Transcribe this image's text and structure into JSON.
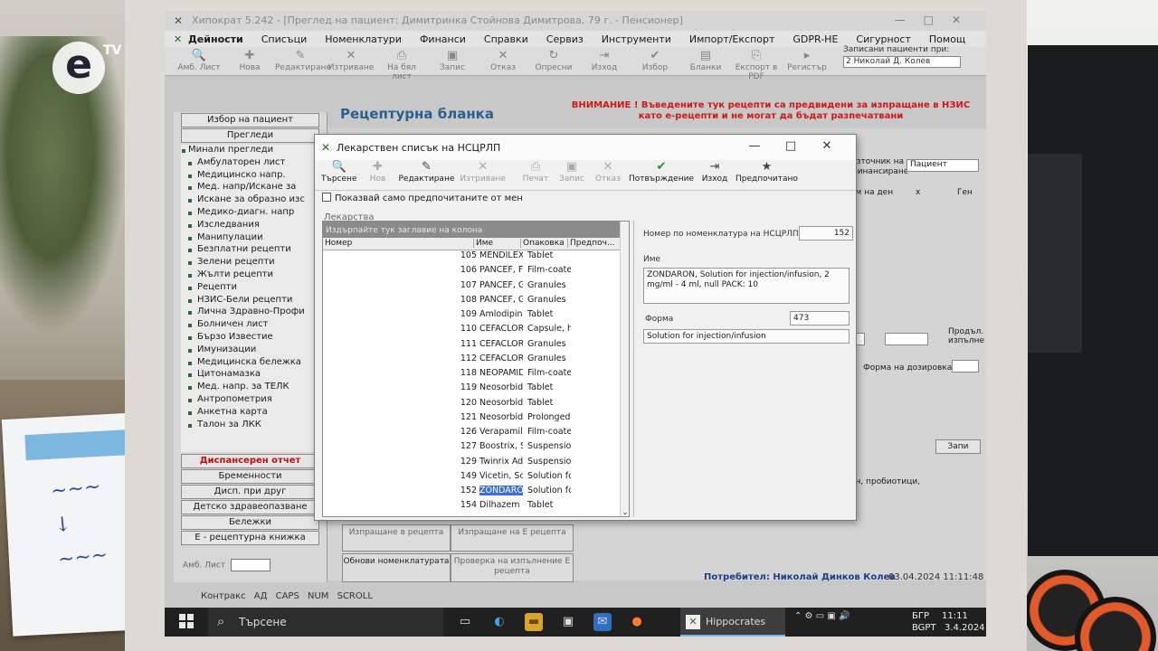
{
  "app": {
    "title": "Хипократ 5.242 - [Преглед на пациент: Димитринка Стойнова Димитрова, 79 г. - Пенсионер]",
    "window_controls": [
      "—",
      "□",
      "✕"
    ]
  },
  "menu": [
    "Дейности",
    "Списъци",
    "Номенклатури",
    "Финанси",
    "Справки",
    "Сервиз",
    "Инструменти",
    "Импорт/Експорт",
    "GDPR-НЕ",
    "Сигурност",
    "Помощ"
  ],
  "menu_right": {
    "label": "Записани пациенти при:",
    "value": "2 Николай Д. Колев"
  },
  "toolbar": [
    "Амб. Лист",
    "Нова",
    "Редактиране",
    "Изтриване",
    "На бял лист",
    "Запис",
    "Отказ",
    "Опресни",
    "Изход",
    "Избор",
    "Бланки",
    "Експорт в PDF",
    "Регистър"
  ],
  "left_panel": {
    "patient_button": "Избор на пациент",
    "reviews_button": "Прегледи",
    "tree": [
      "Минали прегледи",
      "Амбулаторен лист",
      "Медицинско напр.",
      "Мед. напр/Искане за",
      "Искане за образно изс",
      "Медико-диагн. напр",
      "Изследвания",
      "Манипулации",
      "Безплатни рецепти",
      "Зелени рецепти",
      "Жълти рецепти",
      "Рецепти",
      "НЗИС-Бели рецепти",
      "Лична Здравно-Профи",
      "Болничен лист",
      "Бързо Известие",
      "Имунизации",
      "Медицинска бележка",
      "Цитонамазка",
      "Мед. напр. за ТЕЛК",
      "Антропометрия",
      "Анкетна карта",
      "Талон за ЛКК"
    ],
    "buttons": [
      "Диспансерен отчет",
      "Бременности",
      "Дисп. при друг",
      "Детско здравеопазване",
      "Бележки",
      "Е - рецептурна книжка"
    ],
    "amb_list_label": "Амб. Лист"
  },
  "main": {
    "title": "Рецептурна бланка",
    "warning": "ВНИМАНИЕ ! Въведените тук рецепти са предвидени за изпращане в НЗИС като е-рецепти и не могат да бъдат разпечатвани",
    "source_label": "Източник на финансиране",
    "source_value": "Пациент",
    "per_day_label": "ем на ден",
    "times_label": "x",
    "gen_label": "Ген",
    "duration_label": "Продъл. изпълне",
    "dose_form_label": "Форма на дозировка",
    "save_label": "Запи",
    "probiotics_text": "ен, пробиотици,",
    "bottom_buttons": [
      "Изпращане в рецепта",
      "Изпращане на Е рецепта",
      "Обнови номенклатурата",
      "Проверка на изпълнение Е рецепта"
    ],
    "status_user": "Потребител: Николай Динков Колев",
    "status_datetime": "03.04.2024 11:11:48",
    "statusbar": "Контракс АД  CAPS  NUM  SCROLL"
  },
  "dialog": {
    "title": "Лекарствен списък на НСЦРЛП",
    "toolbar": [
      "Търсене",
      "Нов",
      "Редактиране",
      "Изтриване",
      "Печат",
      "Запис",
      "Отказ",
      "Потвърждение",
      "Изход",
      "Предпочитано"
    ],
    "checkbox_label": "Показвай само предпочитаните от мен",
    "group_label": "Лекарства",
    "group_hint": "Издърпайте тук заглавие на колона",
    "columns": [
      "Номер",
      "Име",
      "Опаковка",
      "Предпоч..."
    ],
    "rows": [
      {
        "no": "105",
        "name": "MENDILEX",
        "form": "Tablet"
      },
      {
        "no": "106",
        "name": "PANCEF, Fi",
        "form": "Film-coated"
      },
      {
        "no": "107",
        "name": "PANCEF, G",
        "form": "Granules"
      },
      {
        "no": "108",
        "name": "PANCEF, G",
        "form": "Granules"
      },
      {
        "no": "109",
        "name": "Amlodipin A",
        "form": "Tablet"
      },
      {
        "no": "110",
        "name": "CEFACLOR",
        "form": "Capsule, ha"
      },
      {
        "no": "111",
        "name": "CEFACLOR",
        "form": "Granules"
      },
      {
        "no": "112",
        "name": "CEFACLOR",
        "form": "Granules"
      },
      {
        "no": "118",
        "name": "NEOPAMID",
        "form": "Film-coated"
      },
      {
        "no": "119",
        "name": "Neosorbid,",
        "form": "Tablet"
      },
      {
        "no": "120",
        "name": "Neosorbid,",
        "form": "Tablet"
      },
      {
        "no": "121",
        "name": "Neosorbid, I",
        "form": "Prolonged-r"
      },
      {
        "no": "126",
        "name": "Verapamil S",
        "form": "Film-coated"
      },
      {
        "no": "127",
        "name": "Boostrix, Su",
        "form": "Suspension"
      },
      {
        "no": "129",
        "name": "Twinrix Adu",
        "form": "Suspension"
      },
      {
        "no": "149",
        "name": "Vicetin, Sol",
        "form": "Solution for"
      },
      {
        "no": "152",
        "name": "ZONDARO",
        "form": "Solution for",
        "selected": true
      },
      {
        "no": "154",
        "name": "Dilhazem Sc",
        "form": "Tablet"
      }
    ],
    "detail": {
      "nomenclature_label": "Номер по номенклатура на НСЦРЛП",
      "nomenclature_value": "152",
      "name_label": "Име",
      "name_value": "ZONDARON, Solution for injection/infusion, 2 mg/ml - 4 ml, null PACK: 10",
      "form_label": "Форма",
      "form_code": "473",
      "form_value": "Solution for injection/infusion"
    }
  },
  "taskbar": {
    "search": "Търсене",
    "active_app": "Hippocrates",
    "lang": "БГР",
    "lang2": "BGPT",
    "time": "11:11",
    "date": "3.4.2024 г."
  },
  "colors": {
    "accent_title": "#2a5f92",
    "warning_red": "#d11818",
    "selection_blue": "#3f6fd0",
    "status_user_blue": "#1a3f86"
  }
}
